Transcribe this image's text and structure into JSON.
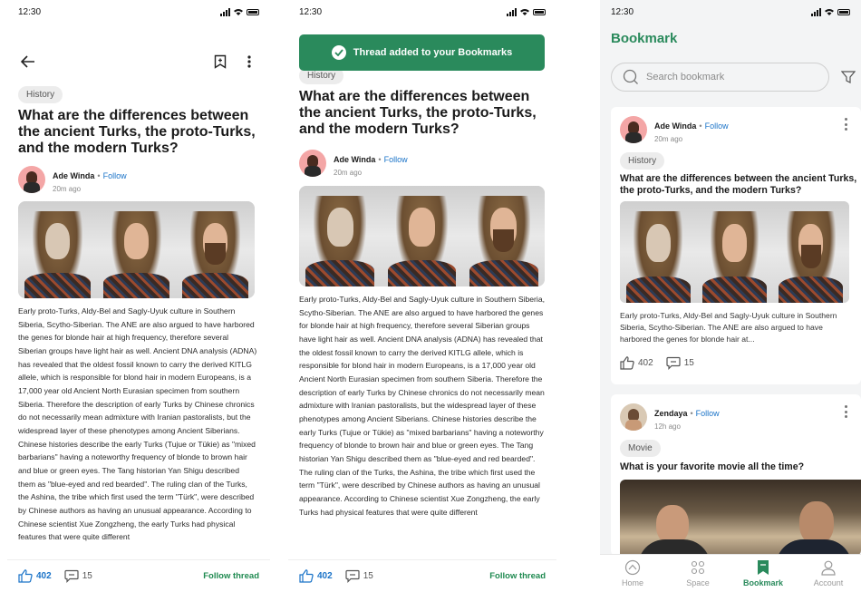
{
  "status": {
    "time": "12:30"
  },
  "post": {
    "category": "History",
    "title": "What are the differences between the ancient Turks, the proto-Turks, and the modern Turks?",
    "author": "Ade Winda",
    "follow": "Follow",
    "time": "20m ago",
    "body": "Early proto-Turks, Aldy-Bel and Sagly-Uyuk culture in Southern Siberia, Scytho-Siberian. The ANE are also argued to have harbored the genes for blonde hair at high frequency, therefore several Siberian groups have light hair as well. Ancient DNA analysis (ADNA) has revealed that the oldest fossil known to carry the derived KITLG allele, which is responsible for blond hair in modern Europeans, is a 17,000 year old Ancient North Eurasian specimen from southern Siberia. Therefore the description of early Turks by Chinese chronics do not necessarily mean admixture with Iranian pastoralists, but the widespread layer of these phenotypes among Ancient Siberians. Chinese histories describe the early Turks (Tujue or Tükie) as \"mixed barbarians\" having a noteworthy frequency of blonde to brown hair and blue or green eyes. The Tang historian Yan Shigu described them as \"blue-eyed and red bearded\". The ruling clan of the Turks, the Ashina, the tribe which first used the term \"Türk\", were described by Chinese authors as having an unusual appearance. According to Chinese scientist Xue Zongzheng, the early Turks had physical features that were quite different",
    "likes": "402",
    "comments": "15",
    "follow_thread": "Follow thread"
  },
  "toast": {
    "message": "Thread added to your Bookmarks"
  },
  "bookmark": {
    "title": "Bookmark",
    "search_placeholder": "Search bookmark",
    "card1": {
      "author": "Ade Winda",
      "follow": "Follow",
      "time": "20m ago",
      "category": "History",
      "title": "What are the differences between the ancient Turks, the proto-Turks, and the modern Turks?",
      "excerpt": "Early proto-Turks, Aldy-Bel and Sagly-Uyuk culture in Southern Siberia, Scytho-Siberian. The ANE are also argued to have harbored the genes for blonde hair at...",
      "likes": "402",
      "comments": "15"
    },
    "card2": {
      "author": "Zendaya",
      "follow": "Follow",
      "time": "12h ago",
      "category": "Movie",
      "title": "What is your favorite movie all the time?"
    },
    "nav": [
      {
        "label": "Home",
        "icon": "home-icon"
      },
      {
        "label": "Space",
        "icon": "space-icon"
      },
      {
        "label": "Bookmark",
        "icon": "bookmark-icon"
      },
      {
        "label": "Account",
        "icon": "account-icon"
      }
    ]
  },
  "colors": {
    "accent_green": "#2a8a5c",
    "link_blue": "#1a73c8"
  }
}
